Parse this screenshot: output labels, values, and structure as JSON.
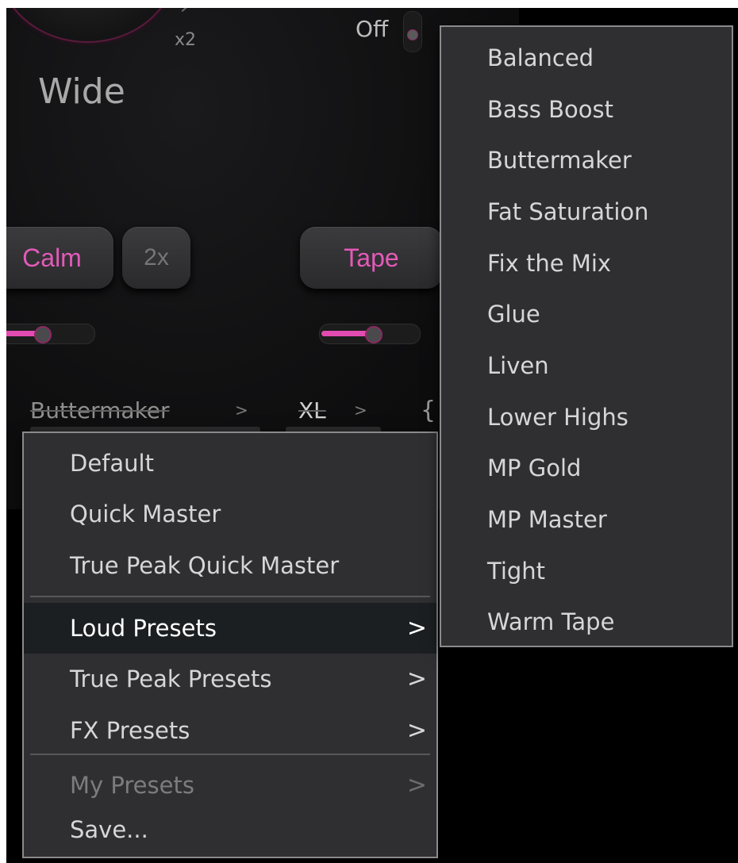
{
  "plugin": {
    "knob_multiplier": "x2",
    "stereo_label": "Wide",
    "toggle_label": "Off",
    "buttons": {
      "calm": "Calm",
      "double": "2x",
      "tape": "Tape"
    },
    "sliders": {
      "calm_level": 0.45,
      "tape_level": 0.55
    },
    "accent_color": "#e24bb1"
  },
  "breadcrumb": {
    "preset": "Buttermaker",
    "sep1": ">",
    "quality": "XL",
    "sep2": ">",
    "extra": "{"
  },
  "preset_menu": {
    "items": [
      {
        "label": "Default"
      },
      {
        "label": "Quick Master"
      },
      {
        "label": "True Peak Quick Master"
      },
      {
        "label": "Loud Presets",
        "submenu": ">",
        "highlighted": true
      },
      {
        "label": "True Peak Presets",
        "submenu": ">"
      },
      {
        "label": "FX Presets",
        "submenu": ">"
      },
      {
        "label": "My Presets",
        "submenu": ">",
        "disabled": true
      },
      {
        "label": "Save..."
      }
    ]
  },
  "loud_presets_submenu": {
    "items": [
      "Balanced",
      "Bass Boost",
      "Buttermaker",
      "Fat Saturation",
      "Fix the Mix",
      "Glue",
      "Liven",
      "Lower Highs",
      "MP Gold",
      "MP Master",
      "Tight",
      "Warm Tape"
    ]
  }
}
